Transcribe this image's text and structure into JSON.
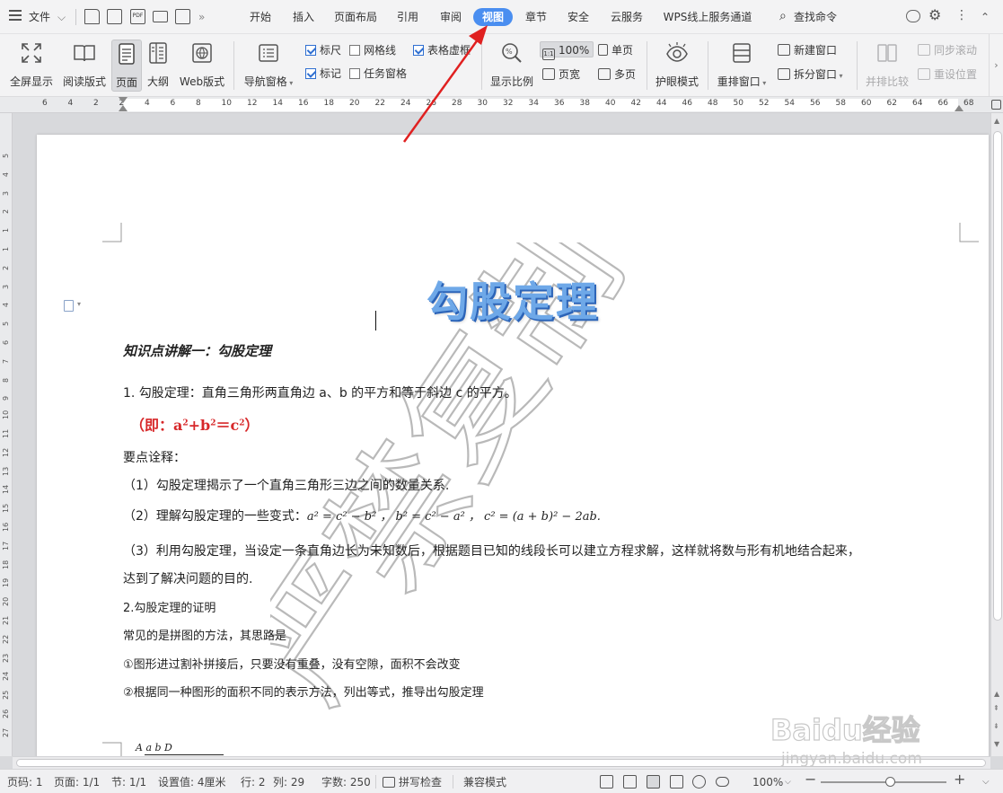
{
  "menubar": {
    "file_label": "文件",
    "tabs": [
      "开始",
      "插入",
      "页面布局",
      "引用",
      "审阅",
      "视图",
      "章节",
      "安全",
      "云服务",
      "WPS线上服务通道"
    ],
    "active_tab": "视图",
    "search_label": "查找命令",
    "more_glyph": "»"
  },
  "ribbon": {
    "fullscreen": "全屏显示",
    "reading": "阅读版式",
    "page": "页面",
    "outline": "大纲",
    "web": "Web版式",
    "nav_pane": "导航窗格",
    "ruler": "标尺",
    "gridlines": "网格线",
    "table_gridlines": "表格虚框",
    "marks": "标记",
    "task_pane": "任务窗格",
    "zoom_ratio": "显示比例",
    "zoom_100": "100%",
    "page_width": "页宽",
    "single_page": "单页",
    "multi_page": "多页",
    "eye_protect": "护眼模式",
    "rearrange": "重排窗口",
    "new_window": "新建窗口",
    "split_window": "拆分窗口",
    "side_by_side": "并排比较",
    "sync_scroll": "同步滚动",
    "reset_position": "重设位置"
  },
  "ruler": {
    "h_labels": [
      "6",
      "4",
      "2",
      "2",
      "4",
      "6",
      "8",
      "10",
      "12",
      "14",
      "16",
      "18",
      "20",
      "22",
      "24",
      "26",
      "28",
      "30",
      "32",
      "34",
      "36",
      "38",
      "40",
      "42",
      "44",
      "46",
      "48",
      "50",
      "52",
      "54",
      "56",
      "58",
      "60",
      "62",
      "64",
      "66",
      "68"
    ],
    "v_labels": [
      "5",
      "4",
      "3",
      "2",
      "1",
      "1",
      "2",
      "3",
      "4",
      "5",
      "6",
      "7",
      "8",
      "9",
      "10",
      "11",
      "12",
      "13",
      "14",
      "15",
      "16",
      "17",
      "18",
      "19",
      "20",
      "21",
      "22",
      "23",
      "24",
      "25",
      "26",
      "27"
    ]
  },
  "document": {
    "title": "勾股定理",
    "section_heading": "知识点讲解一：勾股定理",
    "p1": "1. 勾股定理：直角三角形两直角边 a、b 的平方和等于斜边 c 的平方。",
    "formula_prefix": "（即：a",
    "formula_mid": "+b",
    "formula_mid2": "＝c",
    "formula_suffix": "）",
    "sup2": "2",
    "notes_heading": "要点诠释：",
    "note1": "（1）勾股定理揭示了一个直角三角形三边之间的数量关系.",
    "note2_text": "（2）理解勾股定理的一些变式：",
    "note2_math": "a² = c² − b² ，  b² = c² − a² ，   c² = (a + b)² − 2ab.",
    "note3_line1": "（3）利用勾股定理，当设定一条直角边长为未知数后，根据题目已知的线段长可以建立方程求解，这样就将数与形有机地结合起来，",
    "note3_line2": "达到了解决问题的目的.",
    "proof_heading": "2.勾股定理的证明",
    "proof_intro": "常见的是拼图的方法，其思路是",
    "proof_step1": "①图形进过割补拼接后，只要没有重叠，没有空隙，面积不会改变",
    "proof_step2": "②根据同一种图形的面积不同的表示方法，列出等式，推导出勾股定理",
    "figure_label": "A    a        b    D",
    "watermark": "严禁复制"
  },
  "statusbar": {
    "page_num": "页码: 1",
    "pages": "页面: 1/1",
    "section": "节: 1/1",
    "setting": "设置值: 4厘米",
    "row": "行: 2",
    "col": "列: 29",
    "words": "字数: 250",
    "spellcheck": "拼写检查",
    "compat": "兼容模式",
    "zoom": "100%",
    "zoom_level_fraction": 0.5
  },
  "overlay": {
    "baidu_text": "Baidu经验",
    "baidu_url": "jingyan.baidu.com"
  },
  "colors": {
    "accent": "#4a8ef0",
    "title_blue": "#6ea8e8",
    "formula_red": "#d7282a",
    "arrow_red": "#e02020"
  }
}
